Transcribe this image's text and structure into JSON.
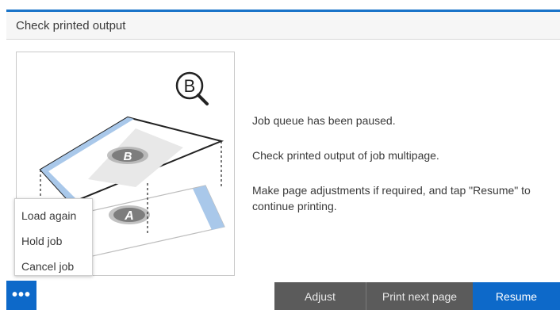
{
  "header": {
    "title": "Check printed output"
  },
  "illustration": {
    "badge_top": "B",
    "badge_sheet_top": "B",
    "badge_sheet_bottom": "A"
  },
  "messages": {
    "line1": "Job queue has been paused.",
    "line2": "Check printed output of job multipage.",
    "line3": "Make page adjustments if required, and tap \"Resume\" to continue printing."
  },
  "popup_menu": {
    "items": [
      "Load again",
      "Hold job",
      "Cancel job"
    ]
  },
  "footer": {
    "more_label": "•••",
    "adjust": "Adjust",
    "print_next": "Print next page",
    "resume": "Resume"
  },
  "colors": {
    "accent": "#0d69c9",
    "button_dark": "#5b5b5b",
    "sheet_edge_blue": "#a9c8ea"
  }
}
